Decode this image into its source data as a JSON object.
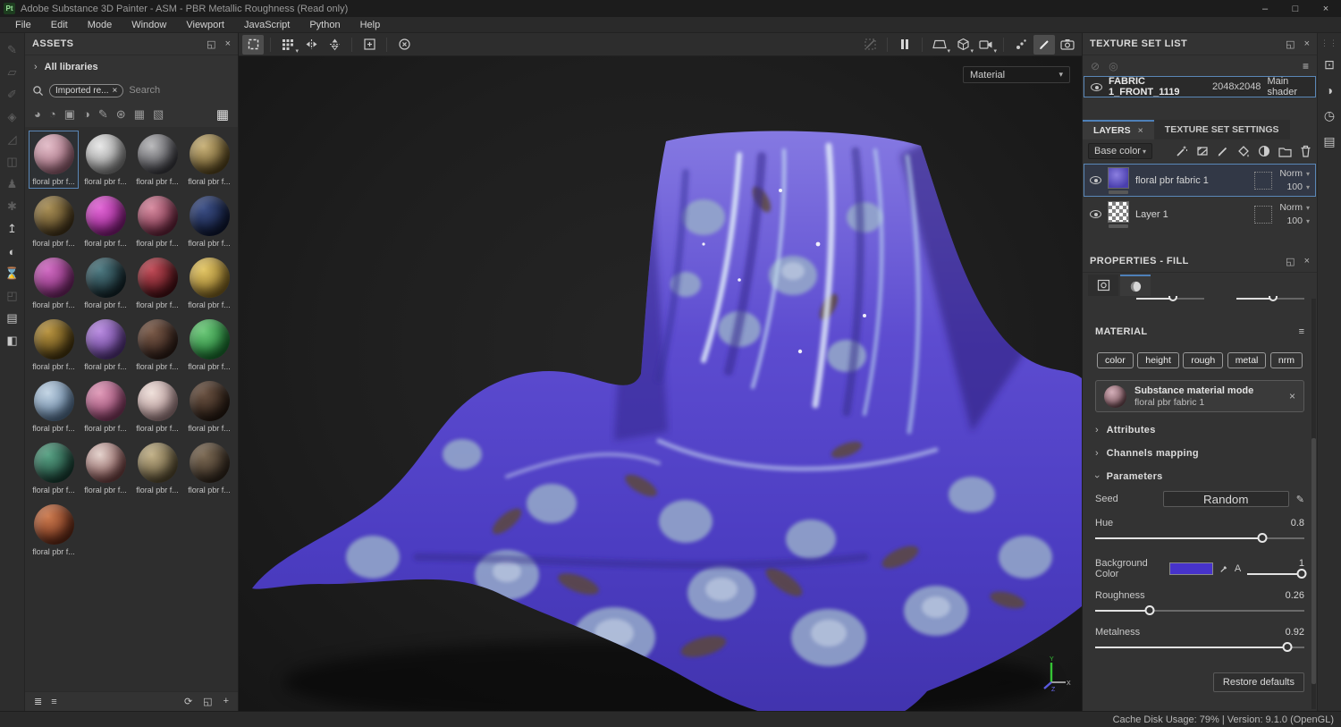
{
  "window": {
    "app_badge": "Pt",
    "title": "Adobe Substance 3D Painter - ASM - PBR Metallic Roughness (Read only)",
    "controls": {
      "minimize": "–",
      "maximize": "□",
      "close": "×"
    }
  },
  "menu": {
    "items": [
      "File",
      "Edit",
      "Mode",
      "Window",
      "Viewport",
      "JavaScript",
      "Python",
      "Help"
    ]
  },
  "left_toolbar": {
    "items": [
      {
        "name": "paint-tool",
        "glyph": "✎",
        "bright": false
      },
      {
        "name": "eraser-tool",
        "glyph": "▱",
        "bright": false
      },
      {
        "name": "projection-tool",
        "glyph": "✐",
        "bright": false
      },
      {
        "name": "polygon-fill-tool",
        "glyph": "◈",
        "bright": false
      },
      {
        "name": "smudge-tool",
        "glyph": "◿",
        "bright": false
      },
      {
        "name": "clone-tool",
        "glyph": "◫",
        "bright": false
      },
      {
        "name": "stamp-tool",
        "glyph": "♟",
        "bright": false
      },
      {
        "name": "particles-tool",
        "glyph": "✱",
        "bright": false
      },
      {
        "name": "export-textures",
        "glyph": "↥",
        "bright": true
      },
      {
        "name": "material-picker",
        "glyph": "◐",
        "bright": true
      },
      {
        "name": "bake-pending",
        "glyph": "⌛",
        "bright": false
      },
      {
        "name": "fullscreen-toggle",
        "glyph": "◰",
        "bright": false
      },
      {
        "name": "display-settings",
        "glyph": "▤",
        "bright": true
      },
      {
        "name": "shader-settings",
        "glyph": "◧",
        "bright": true
      }
    ]
  },
  "assets": {
    "title": "ASSETS",
    "library_filter": "All libraries",
    "search": {
      "tag": "Imported re...",
      "tag_close": "×",
      "placeholder": "Search"
    },
    "filter_icons": [
      {
        "name": "filter-materials-icon",
        "glyph": "◕"
      },
      {
        "name": "filter-smart-materials-icon",
        "glyph": "◔"
      },
      {
        "name": "filter-smart-masks-icon",
        "glyph": "▣"
      },
      {
        "name": "filter-filters-icon",
        "glyph": "◑"
      },
      {
        "name": "filter-brushes-icon",
        "glyph": "✎"
      },
      {
        "name": "filter-alphas-icon",
        "glyph": "⊛"
      },
      {
        "name": "filter-textures-icon",
        "glyph": "▦"
      },
      {
        "name": "filter-environments-icon",
        "glyph": "▧"
      }
    ],
    "grid_view_glyph": "▦",
    "items": [
      {
        "label": "floral pbr f...",
        "c1": "#e3bcc8",
        "c2": "#9c6678",
        "selected": true
      },
      {
        "label": "floral pbr f...",
        "c1": "#e8e8e8",
        "c2": "#8a8a8a"
      },
      {
        "label": "floral pbr f...",
        "c1": "#b9b9bb",
        "c2": "#3f3f45"
      },
      {
        "label": "floral pbr f...",
        "c1": "#c9b279",
        "c2": "#5e4c22"
      },
      {
        "label": "floral pbr f...",
        "c1": "#a98f55",
        "c2": "#4a3a1e"
      },
      {
        "label": "floral pbr f...",
        "c1": "#e266d6",
        "c2": "#8c1f84"
      },
      {
        "label": "floral pbr f...",
        "c1": "#d88ba0",
        "c2": "#6e2840"
      },
      {
        "label": "floral pbr f...",
        "c1": "#3c4f86",
        "c2": "#101a38"
      },
      {
        "label": "floral pbr f...",
        "c1": "#d06ac2",
        "c2": "#7a2a6e"
      },
      {
        "label": "floral pbr f...",
        "c1": "#4e7a82",
        "c2": "#16282e"
      },
      {
        "label": "floral pbr f...",
        "c1": "#c04a56",
        "c2": "#4e1218"
      },
      {
        "label": "floral pbr f...",
        "c1": "#e2c564",
        "c2": "#8a6d26"
      },
      {
        "label": "floral pbr f...",
        "c1": "#b99440",
        "c2": "#4e3c12"
      },
      {
        "label": "floral pbr f...",
        "c1": "#b88ae0",
        "c2": "#5c3a88"
      },
      {
        "label": "floral pbr f...",
        "c1": "#7a5a48",
        "c2": "#32201a"
      },
      {
        "label": "floral pbr f...",
        "c1": "#6cc878",
        "c2": "#1e7a34"
      },
      {
        "label": "floral pbr f...",
        "c1": "#c2d4e4",
        "c2": "#5c7a9a"
      },
      {
        "label": "floral pbr f...",
        "c1": "#e09ab8",
        "c2": "#8c4068"
      },
      {
        "label": "floral pbr f...",
        "c1": "#efe0da",
        "c2": "#a8888a"
      },
      {
        "label": "floral pbr f...",
        "c1": "#6a5242",
        "c2": "#291c14"
      },
      {
        "label": "floral pbr f...",
        "c1": "#58a284",
        "c2": "#1c4438"
      },
      {
        "label": "floral pbr f...",
        "c1": "#e4d2cc",
        "c2": "#7c4a4a"
      },
      {
        "label": "floral pbr f...",
        "c1": "#c2b188",
        "c2": "#5e5236"
      },
      {
        "label": "floral pbr f...",
        "c1": "#7c6a54",
        "c2": "#352a20"
      },
      {
        "label": "floral pbr f...",
        "c1": "#cc7a4e",
        "c2": "#6e2f1a"
      }
    ]
  },
  "viewport": {
    "shading_mode": "Material",
    "axis": {
      "x": "X",
      "y": "Y",
      "z": "Z"
    }
  },
  "texture_set": {
    "title": "TEXTURE SET LIST",
    "row": {
      "name": "FABRIC 1_FRONT_1119",
      "resolution": "2048x2048",
      "shader": "Main shader"
    }
  },
  "tabs": {
    "layers": "LAYERS",
    "layers_close": "×",
    "settings": "TEXTURE SET SETTINGS"
  },
  "layers": {
    "channel_filter": "Base color",
    "rows": [
      {
        "name": "floral pbr fabric 1",
        "blend": "Norm",
        "opacity": "100"
      },
      {
        "name": "Layer 1",
        "blend": "Norm",
        "opacity": "100"
      }
    ]
  },
  "properties": {
    "title": "PROPERTIES - FILL",
    "material_header": "MATERIAL",
    "channels": [
      "color",
      "height",
      "rough",
      "metal",
      "nrm"
    ],
    "material_slot": {
      "mode": "Substance material mode",
      "name": "floral pbr fabric 1"
    },
    "sections": {
      "attributes": "Attributes",
      "channels_mapping": "Channels mapping",
      "parameters": "Parameters"
    },
    "params": {
      "seed": {
        "label": "Seed",
        "value": "Random"
      },
      "hue": {
        "label": "Hue",
        "value": "0.8"
      },
      "background_color": {
        "label": "Background Color",
        "swatch": "#4733cb",
        "alpha_label": "A",
        "alpha_value": "1"
      },
      "roughness": {
        "label": "Roughness",
        "value": "0.26"
      },
      "metalness": {
        "label": "Metalness",
        "value": "0.92"
      }
    },
    "restore_label": "Restore defaults"
  },
  "far_toolbar": {
    "items": [
      {
        "name": "viewport-capture",
        "glyph": "⊡"
      },
      {
        "name": "shader-ball",
        "glyph": "◑"
      },
      {
        "name": "history-log",
        "glyph": "◷"
      },
      {
        "name": "log-panel",
        "glyph": "▤"
      }
    ]
  },
  "icons": {
    "chevron_down": "▾",
    "chevron_right": "›",
    "close": "×",
    "popout": "◱",
    "filter_menu": "≡",
    "plus": "+",
    "refresh": "⟳",
    "pencil": "✎",
    "list_a": "≣",
    "list_b": "≡",
    "eye_off": "⊘",
    "eye_solo": "◎"
  },
  "status": {
    "right": "Cache Disk Usage:  79% | Version: 9.1.0 (OpenGL)"
  }
}
